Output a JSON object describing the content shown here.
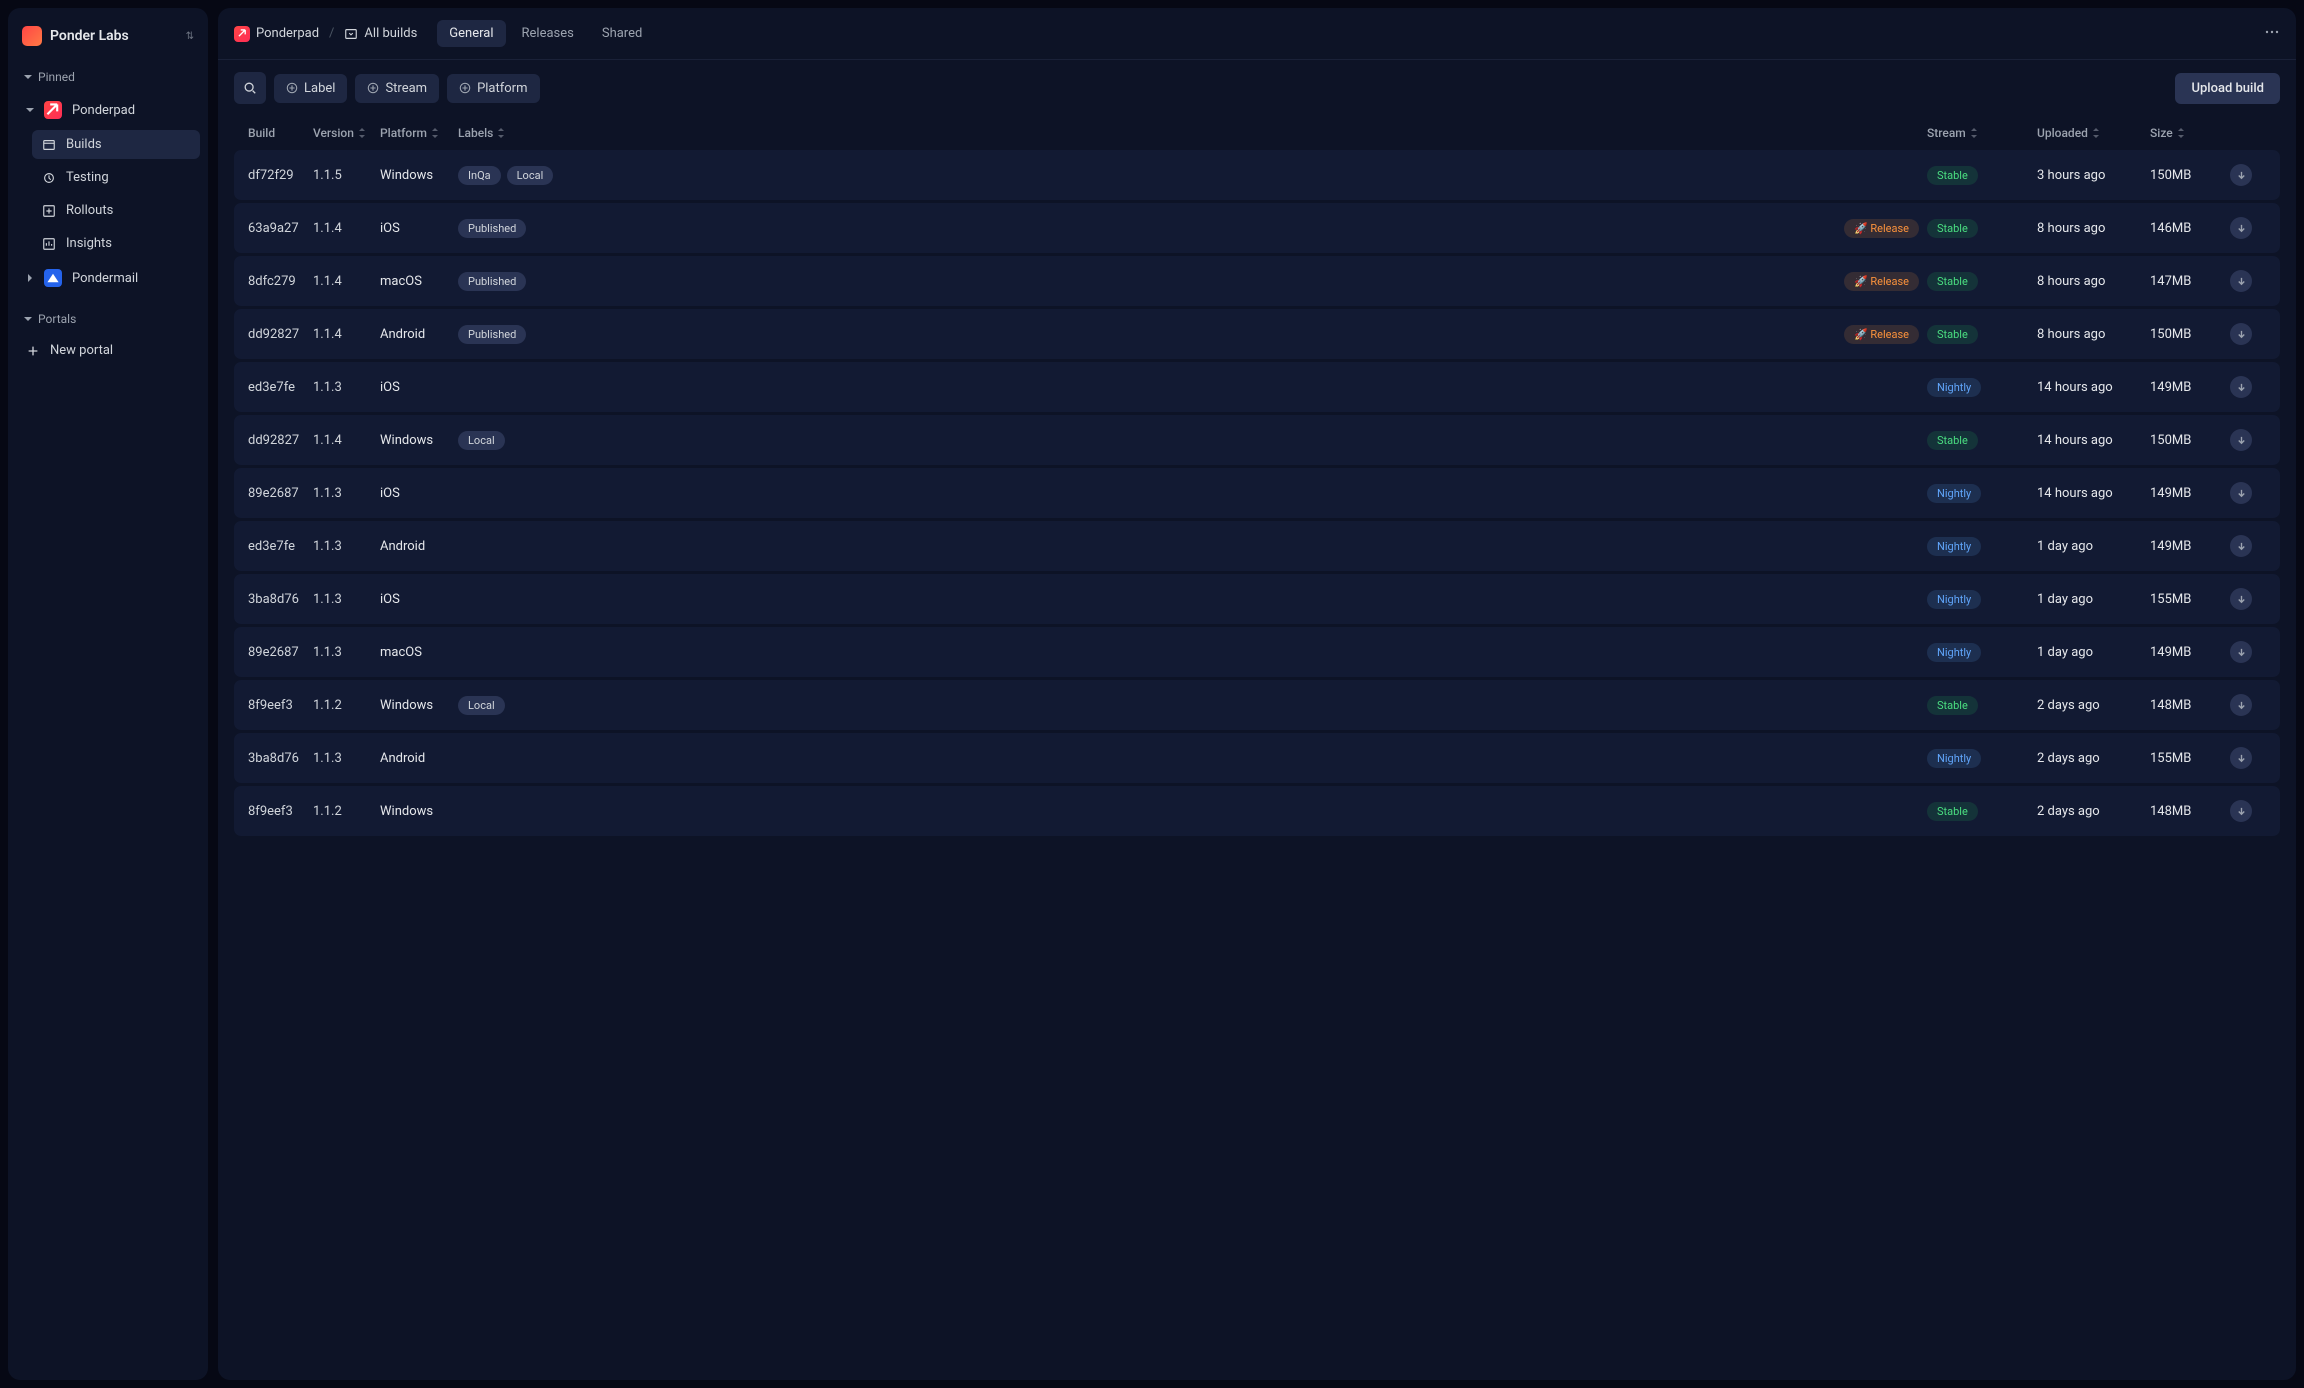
{
  "org": {
    "name": "Ponder Labs"
  },
  "sidebar": {
    "pinned_label": "Pinned",
    "app1": "Ponderpad",
    "items": {
      "builds": "Builds",
      "testing": "Testing",
      "rollouts": "Rollouts",
      "insights": "Insights"
    },
    "app2": "Pondermail",
    "portals_label": "Portals",
    "new_portal": "New portal"
  },
  "breadcrumb": {
    "app": "Ponderpad",
    "page": "All builds"
  },
  "tabs": {
    "general": "General",
    "releases": "Releases",
    "shared": "Shared"
  },
  "filters": {
    "label": "Label",
    "stream": "Stream",
    "platform": "Platform"
  },
  "upload_label": "Upload build",
  "columns": {
    "build": "Build",
    "version": "Version",
    "platform": "Platform",
    "labels": "Labels",
    "stream": "Stream",
    "uploaded": "Uploaded",
    "size": "Size"
  },
  "release_label": "Release",
  "rows": [
    {
      "build": "df72f29",
      "version": "1.1.5",
      "platform": "Windows",
      "labels": [
        "InQa",
        "Local"
      ],
      "release": false,
      "stream": "Stable",
      "uploaded": "3 hours ago",
      "size": "150MB"
    },
    {
      "build": "63a9a27",
      "version": "1.1.4",
      "platform": "iOS",
      "labels": [
        "Published"
      ],
      "release": true,
      "stream": "Stable",
      "uploaded": "8 hours ago",
      "size": "146MB"
    },
    {
      "build": "8dfc279",
      "version": "1.1.4",
      "platform": "macOS",
      "labels": [
        "Published"
      ],
      "release": true,
      "stream": "Stable",
      "uploaded": "8 hours ago",
      "size": "147MB"
    },
    {
      "build": "dd92827",
      "version": "1.1.4",
      "platform": "Android",
      "labels": [
        "Published"
      ],
      "release": true,
      "stream": "Stable",
      "uploaded": "8 hours ago",
      "size": "150MB"
    },
    {
      "build": "ed3e7fe",
      "version": "1.1.3",
      "platform": "iOS",
      "labels": [],
      "release": false,
      "stream": "Nightly",
      "uploaded": "14 hours ago",
      "size": "149MB"
    },
    {
      "build": "dd92827",
      "version": "1.1.4",
      "platform": "Windows",
      "labels": [
        "Local"
      ],
      "release": false,
      "stream": "Stable",
      "uploaded": "14 hours ago",
      "size": "150MB"
    },
    {
      "build": "89e2687",
      "version": "1.1.3",
      "platform": "iOS",
      "labels": [],
      "release": false,
      "stream": "Nightly",
      "uploaded": "14 hours ago",
      "size": "149MB"
    },
    {
      "build": "ed3e7fe",
      "version": "1.1.3",
      "platform": "Android",
      "labels": [],
      "release": false,
      "stream": "Nightly",
      "uploaded": "1 day ago",
      "size": "149MB"
    },
    {
      "build": "3ba8d76",
      "version": "1.1.3",
      "platform": "iOS",
      "labels": [],
      "release": false,
      "stream": "Nightly",
      "uploaded": "1 day ago",
      "size": "155MB"
    },
    {
      "build": "89e2687",
      "version": "1.1.3",
      "platform": "macOS",
      "labels": [],
      "release": false,
      "stream": "Nightly",
      "uploaded": "1 day ago",
      "size": "149MB"
    },
    {
      "build": "8f9eef3",
      "version": "1.1.2",
      "platform": "Windows",
      "labels": [
        "Local"
      ],
      "release": false,
      "stream": "Stable",
      "uploaded": "2 days ago",
      "size": "148MB"
    },
    {
      "build": "3ba8d76",
      "version": "1.1.3",
      "platform": "Android",
      "labels": [],
      "release": false,
      "stream": "Nightly",
      "uploaded": "2 days ago",
      "size": "155MB"
    },
    {
      "build": "8f9eef3",
      "version": "1.1.2",
      "platform": "Windows",
      "labels": [],
      "release": false,
      "stream": "Stable",
      "uploaded": "2 days ago",
      "size": "148MB"
    }
  ]
}
